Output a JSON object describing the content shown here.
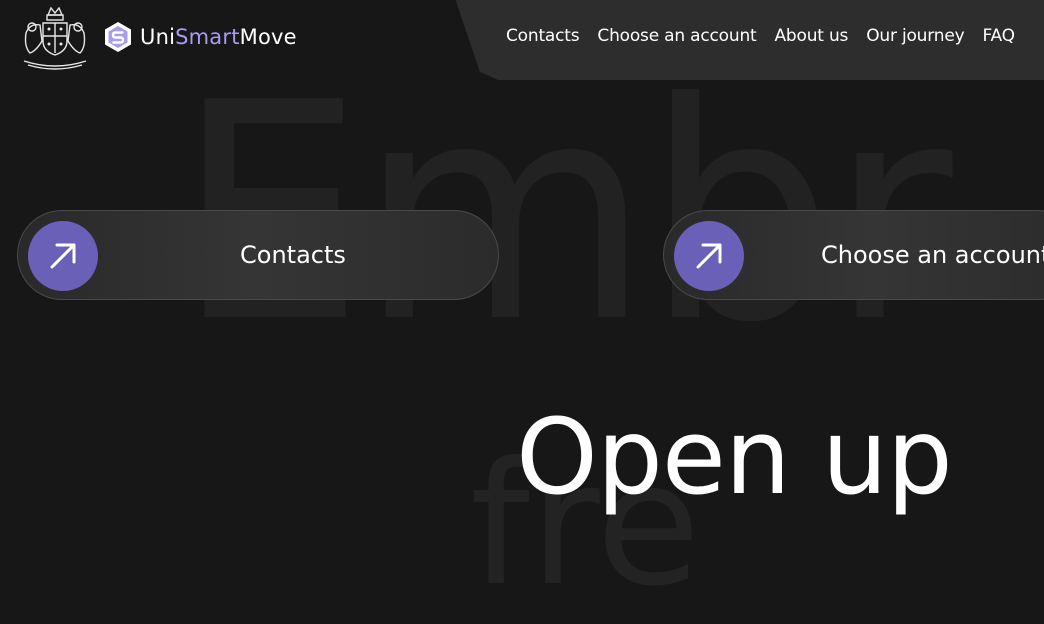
{
  "logo": {
    "part1": "Uni",
    "part2": "Smart",
    "part3": "Move"
  },
  "nav": {
    "items": [
      {
        "label": "Contacts"
      },
      {
        "label": "Choose an account"
      },
      {
        "label": "About us"
      },
      {
        "label": "Our journey"
      },
      {
        "label": "FAQ"
      }
    ]
  },
  "background_word": "Embr",
  "background_word2": "fre",
  "cards": [
    {
      "label": "Contacts",
      "icon": "arrow-up-right-icon"
    },
    {
      "label": "Choose an account",
      "icon": "arrow-up-right-icon"
    }
  ],
  "hero": {
    "title": "Open up"
  },
  "colors": {
    "accent": "#6b60b8",
    "brand_light": "#a89cf0",
    "background": "#181718"
  }
}
